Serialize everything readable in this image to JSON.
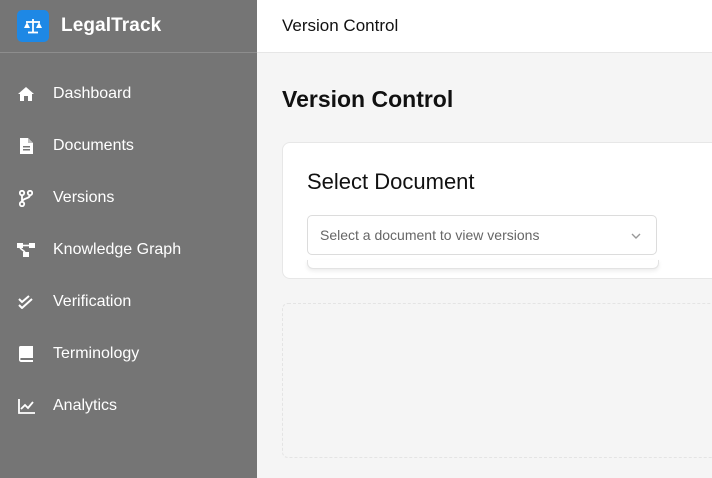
{
  "brand": {
    "name": "LegalTrack",
    "icon": "scale-icon",
    "accent": "#1e88e5"
  },
  "sidebar": {
    "background": "#757575",
    "items": [
      {
        "label": "Dashboard",
        "icon": "home-icon"
      },
      {
        "label": "Documents",
        "icon": "document-icon"
      },
      {
        "label": "Versions",
        "icon": "branch-icon"
      },
      {
        "label": "Knowledge Graph",
        "icon": "graph-icon"
      },
      {
        "label": "Verification",
        "icon": "double-check-icon"
      },
      {
        "label": "Terminology",
        "icon": "book-icon"
      },
      {
        "label": "Analytics",
        "icon": "line-chart-icon"
      }
    ]
  },
  "header": {
    "title": "Version Control"
  },
  "main": {
    "page_title": "Version Control",
    "select_card": {
      "title": "Select Document",
      "select_placeholder": "Select a document to view versions"
    }
  }
}
